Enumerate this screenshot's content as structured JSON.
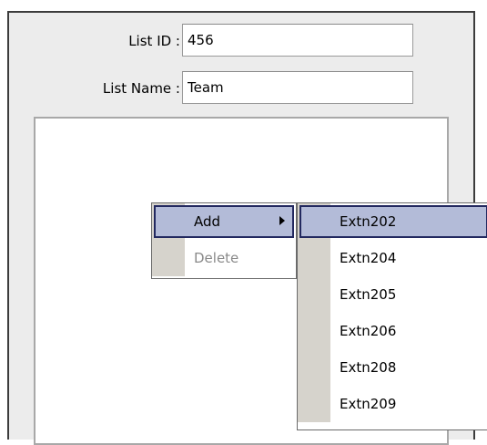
{
  "form": {
    "list_id_label": "List ID :",
    "list_id_value": "456",
    "list_name_label": "List Name :",
    "list_name_value": "Team"
  },
  "context_menu": {
    "items": [
      {
        "label": "Add",
        "highlighted": true,
        "has_submenu": true,
        "enabled": true
      },
      {
        "label": "Delete",
        "highlighted": false,
        "has_submenu": false,
        "enabled": false
      }
    ]
  },
  "submenu": {
    "items": [
      {
        "label": "Extn202",
        "highlighted": true
      },
      {
        "label": "Extn204",
        "highlighted": false
      },
      {
        "label": "Extn205",
        "highlighted": false
      },
      {
        "label": "Extn206",
        "highlighted": false
      },
      {
        "label": "Extn208",
        "highlighted": false
      },
      {
        "label": "Extn209",
        "highlighted": false
      }
    ]
  },
  "colors": {
    "panel_bg": "#ececec",
    "highlight_bg": "#b3bbd8",
    "highlight_border": "#22285f",
    "menu_gutter": "#d6d3cc",
    "disabled_text": "#8a8a8a"
  }
}
